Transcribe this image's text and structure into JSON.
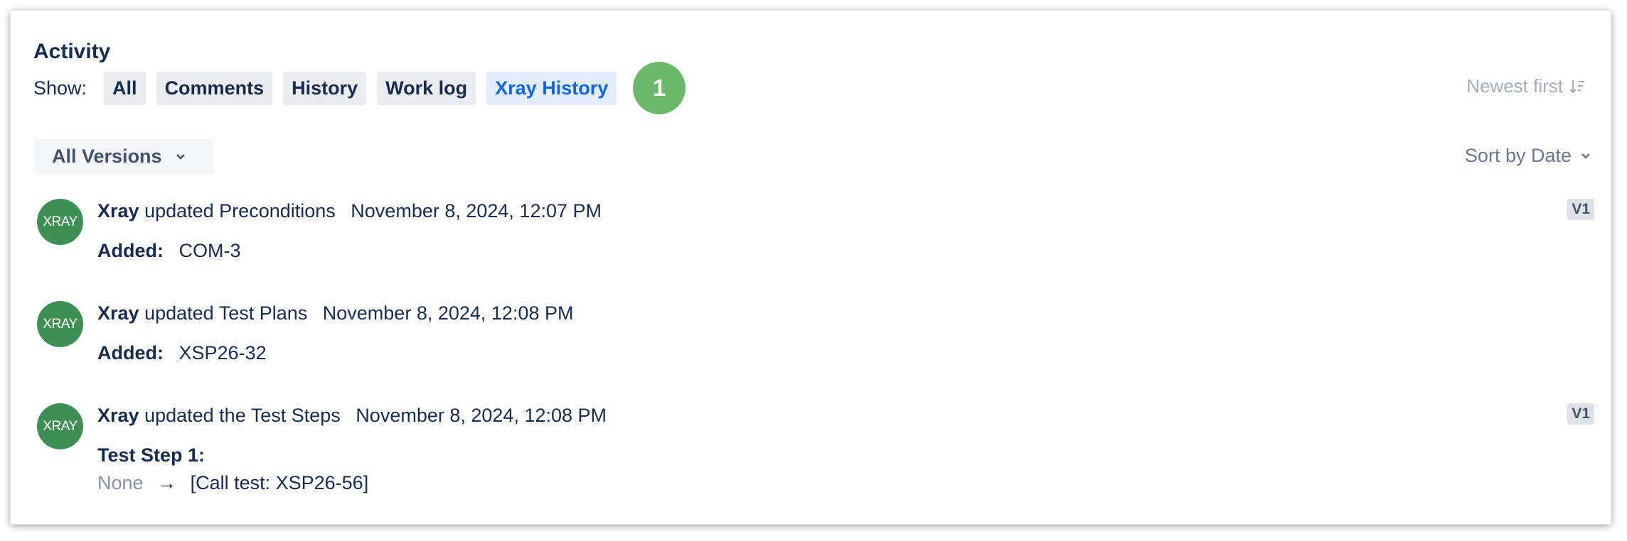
{
  "activity": {
    "title": "Activity",
    "show_label": "Show:",
    "filters": [
      "All",
      "Comments",
      "History",
      "Work log",
      "Xray History"
    ],
    "active_filter": "Xray History",
    "callout_badge": "1",
    "newest_first": "Newest first",
    "versions_dropdown": "All Versions",
    "sort_by": "Sort by Date"
  },
  "entries": [
    {
      "avatar": "XRAY",
      "author": "Xray",
      "action": "updated Preconditions",
      "date": "November 8, 2024, 12:07 PM",
      "label": "Added:",
      "value": "COM-3",
      "version": "V1"
    },
    {
      "avatar": "XRAY",
      "author": "Xray",
      "action": "updated Test Plans",
      "date": "November 8, 2024, 12:08 PM",
      "label": "Added:",
      "value": "XSP26-32"
    },
    {
      "avatar": "XRAY",
      "author": "Xray",
      "action": "updated the Test Steps",
      "date": "November 8, 2024, 12:08 PM",
      "label": "Test Step 1:",
      "old_value": "None",
      "arrow": "→",
      "new_value": "[Call test: XSP26-56]",
      "version": "V1"
    }
  ],
  "colors": {
    "active_filter_text": "#0c66e4",
    "active_filter_bg": "#e4edfd",
    "badge": "#6cb86a",
    "avatar": "#3d8f55"
  },
  "icons": {
    "newest_first": "sort-descending-icon",
    "versions": "chevron-down-icon",
    "sort_by": "chevron-down-icon"
  }
}
